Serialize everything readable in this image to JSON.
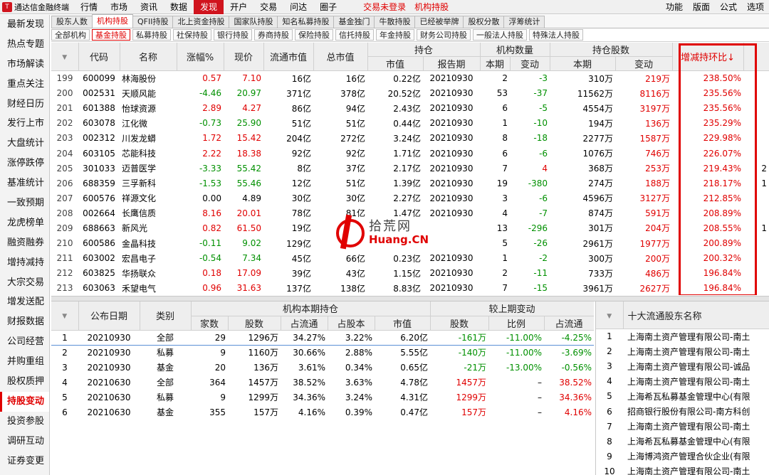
{
  "app": {
    "logo_text": "通达信金融终端",
    "status_alert": "交易未登录",
    "status_mode": "机构持股"
  },
  "menu": {
    "items": [
      "行情",
      "市场",
      "资讯",
      "数据",
      "发现",
      "开户",
      "交易",
      "问达",
      "圈子"
    ],
    "active_index": 4,
    "right_items": [
      "功能",
      "版面",
      "公式",
      "选项"
    ]
  },
  "sidebar": {
    "items": [
      "最新发现",
      "热点专题",
      "市场解读",
      "重点关注",
      "财经日历",
      "发行上市",
      "大盘统计",
      "涨停跌停",
      "基准统计",
      "一致预期",
      "龙虎榜单",
      "融资融券",
      "增持减持",
      "大宗交易",
      "增发送配",
      "财报数据",
      "公司经营",
      "并购重组",
      "股权质押",
      "持股变动",
      "投资参股",
      "调研互动",
      "证券变更"
    ],
    "active_index": 19
  },
  "tabs1": {
    "items": [
      "股东人数",
      "机构持股",
      "QFII持股",
      "北上资金持股",
      "国家队持股",
      "知名私募持股",
      "基金独门",
      "牛散持股",
      "已经被举牌",
      "股权分散",
      "浮筹统计"
    ],
    "active_index": 1
  },
  "tabs2": {
    "items": [
      "全部机构",
      "基金持股",
      "私募持股",
      "社保持股",
      "银行持股",
      "券商持股",
      "保险持股",
      "信托持股",
      "年金持股",
      "财务公司持股",
      "一般法人持股",
      "特殊法人持股"
    ],
    "active_index": 1
  },
  "main_table": {
    "group_headers": {
      "holding": "持仓",
      "inst_count": "机构数量",
      "shares": "持仓股数"
    },
    "columns": [
      "代码",
      "名称",
      "涨幅%",
      "现价",
      "流通市值",
      "总市值",
      "市值",
      "报告期",
      "本期",
      "变动",
      "本期",
      "变动",
      "增减持环比"
    ],
    "sort_indicator": "↓",
    "rows": [
      {
        "idx": "199",
        "code": "600099",
        "name": "林海股份",
        "chg": "0.57",
        "price": "7.10",
        "float_cap": "16亿",
        "total_cap": "16亿",
        "mv": "0.22亿",
        "period": "20210930",
        "inst": "2",
        "inst_chg": "-3",
        "shares": "310万",
        "shares_chg": "219万",
        "ratio": "238.50%",
        "dir": "up",
        "extra": ""
      },
      {
        "idx": "200",
        "code": "002531",
        "name": "天顺风能",
        "chg": "-4.46",
        "price": "20.97",
        "float_cap": "371亿",
        "total_cap": "378亿",
        "mv": "20.52亿",
        "period": "20210930",
        "inst": "53",
        "inst_chg": "-37",
        "shares": "11562万",
        "shares_chg": "8116万",
        "ratio": "235.56%",
        "dir": "down",
        "extra": ""
      },
      {
        "idx": "201",
        "code": "601388",
        "name": "怡球资源",
        "chg": "2.89",
        "price": "4.27",
        "float_cap": "86亿",
        "total_cap": "94亿",
        "mv": "2.43亿",
        "period": "20210930",
        "inst": "6",
        "inst_chg": "-5",
        "shares": "4554万",
        "shares_chg": "3197万",
        "ratio": "235.56%",
        "dir": "up",
        "extra": ""
      },
      {
        "idx": "202",
        "code": "603078",
        "name": "江化微",
        "chg": "-0.73",
        "price": "25.90",
        "float_cap": "51亿",
        "total_cap": "51亿",
        "mv": "0.44亿",
        "period": "20210930",
        "inst": "1",
        "inst_chg": "-10",
        "shares": "194万",
        "shares_chg": "136万",
        "ratio": "235.29%",
        "dir": "down",
        "extra": ""
      },
      {
        "idx": "203",
        "code": "002312",
        "name": "川发龙蟒",
        "chg": "1.72",
        "price": "15.42",
        "float_cap": "204亿",
        "total_cap": "272亿",
        "mv": "3.24亿",
        "period": "20210930",
        "inst": "8",
        "inst_chg": "-18",
        "shares": "2277万",
        "shares_chg": "1587万",
        "ratio": "229.98%",
        "dir": "up",
        "extra": ""
      },
      {
        "idx": "204",
        "code": "603105",
        "name": "芯能科技",
        "chg": "2.22",
        "price": "18.38",
        "float_cap": "92亿",
        "total_cap": "92亿",
        "mv": "1.71亿",
        "period": "20210930",
        "inst": "6",
        "inst_chg": "-6",
        "shares": "1076万",
        "shares_chg": "746万",
        "ratio": "226.07%",
        "dir": "up",
        "extra": ""
      },
      {
        "idx": "205",
        "code": "301033",
        "name": "迈普医学",
        "chg": "-3.33",
        "price": "55.42",
        "float_cap": "8亿",
        "total_cap": "37亿",
        "mv": "2.17亿",
        "period": "20210930",
        "inst": "7",
        "inst_chg": "4",
        "shares": "368万",
        "shares_chg": "253万",
        "ratio": "219.43%",
        "dir": "down",
        "extra": "2"
      },
      {
        "idx": "206",
        "code": "688359",
        "name": "三孚新科",
        "chg": "-1.53",
        "price": "55.46",
        "float_cap": "12亿",
        "total_cap": "51亿",
        "mv": "1.39亿",
        "period": "20210930",
        "inst": "19",
        "inst_chg": "-380",
        "shares": "274万",
        "shares_chg": "188万",
        "ratio": "218.17%",
        "dir": "down",
        "extra": "1"
      },
      {
        "idx": "207",
        "code": "600576",
        "name": "祥源文化",
        "chg": "0.00",
        "price": "4.89",
        "float_cap": "30亿",
        "total_cap": "30亿",
        "mv": "2.27亿",
        "period": "20210930",
        "inst": "3",
        "inst_chg": "-6",
        "shares": "4596万",
        "shares_chg": "3127万",
        "ratio": "212.85%",
        "dir": "flat",
        "extra": ""
      },
      {
        "idx": "208",
        "code": "002664",
        "name": "长鹰信质",
        "chg": "8.16",
        "price": "20.01",
        "float_cap": "78亿",
        "total_cap": "81亿",
        "mv": "1.47亿",
        "period": "20210930",
        "inst": "4",
        "inst_chg": "-7",
        "shares": "874万",
        "shares_chg": "591万",
        "ratio": "208.89%",
        "dir": "up",
        "extra": ""
      },
      {
        "idx": "209",
        "code": "688663",
        "name": "新风光",
        "chg": "0.82",
        "price": "61.50",
        "float_cap": "19亿",
        "total_cap": "",
        "mv": "",
        "period": "",
        "inst": "13",
        "inst_chg": "-296",
        "shares": "301万",
        "shares_chg": "204万",
        "ratio": "208.55%",
        "dir": "up",
        "extra": "1"
      },
      {
        "idx": "210",
        "code": "600586",
        "name": "金晶科技",
        "chg": "-0.11",
        "price": "9.02",
        "float_cap": "129亿",
        "total_cap": "",
        "mv": "",
        "period": "",
        "inst": "5",
        "inst_chg": "-26",
        "shares": "2961万",
        "shares_chg": "1977万",
        "ratio": "200.89%",
        "dir": "down",
        "extra": ""
      },
      {
        "idx": "211",
        "code": "603002",
        "name": "宏昌电子",
        "chg": "-0.54",
        "price": "7.34",
        "float_cap": "45亿",
        "total_cap": "66亿",
        "mv": "0.23亿",
        "period": "20210930",
        "inst": "1",
        "inst_chg": "-2",
        "shares": "300万",
        "shares_chg": "200万",
        "ratio": "200.32%",
        "dir": "down",
        "extra": ""
      },
      {
        "idx": "212",
        "code": "603825",
        "name": "华扬联众",
        "chg": "0.18",
        "price": "17.09",
        "float_cap": "39亿",
        "total_cap": "43亿",
        "mv": "1.15亿",
        "period": "20210930",
        "inst": "2",
        "inst_chg": "-11",
        "shares": "733万",
        "shares_chg": "486万",
        "ratio": "196.84%",
        "dir": "up",
        "extra": ""
      },
      {
        "idx": "213",
        "code": "603063",
        "name": "禾望电气",
        "chg": "0.96",
        "price": "31.63",
        "float_cap": "137亿",
        "total_cap": "138亿",
        "mv": "8.83亿",
        "period": "20210930",
        "inst": "7",
        "inst_chg": "-15",
        "shares": "3961万",
        "shares_chg": "2627万",
        "ratio": "196.84%",
        "dir": "up",
        "extra": ""
      }
    ]
  },
  "bottom_left": {
    "group_headers": {
      "current": "机构本期持仓",
      "change": "较上期变动"
    },
    "columns": [
      "公布日期",
      "类别",
      "家数",
      "股数",
      "占流通",
      "占股本",
      "市值",
      "股数",
      "比例",
      "占流通"
    ],
    "rows": [
      {
        "idx": "1",
        "date": "20210930",
        "cat": "全部",
        "count": "29",
        "shares": "1296万",
        "float_pct": "34.27%",
        "cap_pct": "3.22%",
        "mv": "6.20亿",
        "chg_shares": "-161万",
        "chg_ratio": "-11.00%",
        "chg_float": "-4.25%",
        "sign": "neg"
      },
      {
        "idx": "2",
        "date": "20210930",
        "cat": "私募",
        "count": "9",
        "shares": "1160万",
        "float_pct": "30.66%",
        "cap_pct": "2.88%",
        "mv": "5.55亿",
        "chg_shares": "-140万",
        "chg_ratio": "-11.00%",
        "chg_float": "-3.69%",
        "sign": "neg"
      },
      {
        "idx": "3",
        "date": "20210930",
        "cat": "基金",
        "count": "20",
        "shares": "136万",
        "float_pct": "3.61%",
        "cap_pct": "0.34%",
        "mv": "0.65亿",
        "chg_shares": "-21万",
        "chg_ratio": "-13.00%",
        "chg_float": "-0.56%",
        "sign": "neg"
      },
      {
        "idx": "4",
        "date": "20210630",
        "cat": "全部",
        "count": "364",
        "shares": "1457万",
        "float_pct": "38.52%",
        "cap_pct": "3.63%",
        "mv": "4.78亿",
        "chg_shares": "1457万",
        "chg_ratio": "–",
        "chg_float": "38.52%",
        "sign": "pos"
      },
      {
        "idx": "5",
        "date": "20210630",
        "cat": "私募",
        "count": "9",
        "shares": "1299万",
        "float_pct": "34.36%",
        "cap_pct": "3.24%",
        "mv": "4.31亿",
        "chg_shares": "1299万",
        "chg_ratio": "–",
        "chg_float": "34.36%",
        "sign": "pos"
      },
      {
        "idx": "6",
        "date": "20210630",
        "cat": "基金",
        "count": "355",
        "shares": "157万",
        "float_pct": "4.16%",
        "cap_pct": "0.39%",
        "mv": "0.47亿",
        "chg_shares": "157万",
        "chg_ratio": "–",
        "chg_float": "4.16%",
        "sign": "pos"
      }
    ]
  },
  "bottom_right": {
    "header": "十大流通股东名称",
    "rows": [
      {
        "idx": "1",
        "name": "上海南土资产管理有限公司-南土"
      },
      {
        "idx": "2",
        "name": "上海南土资产管理有限公司-南土"
      },
      {
        "idx": "3",
        "name": "上海南土资产管理有限公司-诚品"
      },
      {
        "idx": "4",
        "name": "上海南土资产管理有限公司-南土"
      },
      {
        "idx": "5",
        "name": "上海希瓦私募基金管理中心(有限"
      },
      {
        "idx": "6",
        "name": "招商银行股份有限公司-南方科创"
      },
      {
        "idx": "7",
        "name": "上海南土资产管理有限公司-南土"
      },
      {
        "idx": "8",
        "name": "上海希瓦私募基金管理中心(有限"
      },
      {
        "idx": "9",
        "name": "上海博鸿资产管理合伙企业(有限"
      },
      {
        "idx": "10",
        "name": "上海南土资产管理有限公司-南土"
      }
    ]
  },
  "watermark": {
    "text_cn": "拾荒网",
    "text_en": "Huang.CN"
  },
  "colors": {
    "up": "#e00000",
    "down": "#009000",
    "highlight_box": "#e00000"
  }
}
